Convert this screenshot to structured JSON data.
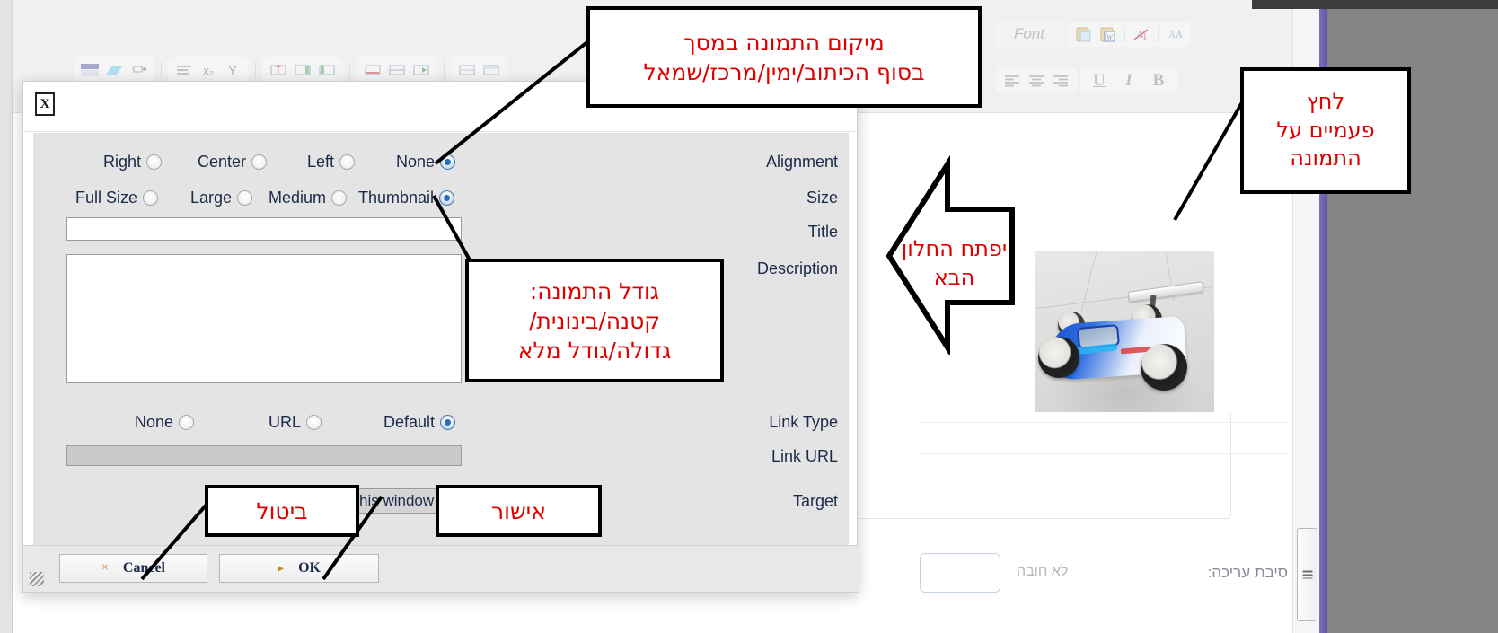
{
  "editor_toolbar": {
    "font_label": "Font",
    "row1_icons": [
      "table-icon",
      "shape-icon",
      "anchor-icon",
      "list-icon",
      "subscript-icon",
      "superscript-icon",
      "table-insert-icon",
      "table-column-right-icon",
      "table-column-left-icon",
      "table-row-delete-icon",
      "table-row-insert-icon",
      "table-merge-icon",
      "table-split-icon",
      "table-props-icon"
    ],
    "row2_icons": [
      "align-left-icon",
      "align-center-icon",
      "align-right-icon"
    ],
    "format_buttons": [
      "U",
      "I",
      "B"
    ],
    "clipboard_icons": [
      "paste-plain-icon",
      "paste-word-icon",
      "remove-format-icon",
      "format-painter-icon"
    ]
  },
  "dialog": {
    "close_label": "X",
    "alignment": {
      "label": "Alignment",
      "options": [
        {
          "label": "Right",
          "checked": false
        },
        {
          "label": "Center",
          "checked": false
        },
        {
          "label": "Left",
          "checked": false
        },
        {
          "label": "None",
          "checked": true
        }
      ]
    },
    "size": {
      "label": "Size",
      "options": [
        {
          "label": "Full Size",
          "checked": false
        },
        {
          "label": "Large",
          "checked": false
        },
        {
          "label": "Medium",
          "checked": false
        },
        {
          "label": "Thumbnail",
          "checked": true
        }
      ]
    },
    "title": {
      "label": "Title",
      "value": "",
      "placeholder": ""
    },
    "description": {
      "label": "Description",
      "value": "",
      "placeholder": ""
    },
    "link_type": {
      "label": "Link Type",
      "options": [
        {
          "label": "None",
          "checked": false
        },
        {
          "label": "URL",
          "checked": false
        },
        {
          "label": "Default",
          "checked": true
        }
      ]
    },
    "link_url": {
      "label": "Link URL",
      "value": ""
    },
    "target": {
      "label": "Target",
      "value": "Open in this window (_self)"
    },
    "buttons": {
      "cancel": "Cancel",
      "cancel_icon": "×",
      "ok": "OK",
      "ok_icon": "▸"
    }
  },
  "background_page": {
    "reason_label": "סיבת עריכה:",
    "reason_hint": "לא חובה",
    "reason_value": ""
  },
  "annotations": [
    {
      "name": "image-position-note",
      "lines": [
        "מיקום התמונה במסך",
        "בסוף הכיתוב/ימין/מרכז/שמאל"
      ]
    },
    {
      "name": "double-click-image-note",
      "lines": [
        "לחץ",
        "פעמיים על",
        "התמונה"
      ]
    },
    {
      "name": "next-window-arrow-note",
      "lines": [
        "יפתח החלון",
        "הבא"
      ]
    },
    {
      "name": "image-size-note",
      "lines": [
        "גודל התמונה:",
        "קטנה/בינונית/",
        "גדולה/גודל מלא"
      ]
    },
    {
      "name": "cancel-note",
      "lines": [
        "ביטול"
      ]
    },
    {
      "name": "ok-note",
      "lines": [
        "אישור"
      ]
    }
  ],
  "colors": {
    "annotation_text": "#e00000",
    "annotation_border": "#000000",
    "dialog_body": "#e4e4e4",
    "label_text": "#1c2a4a",
    "radio_checked": "#2a6bc4",
    "purple_strip": "#6a61ae",
    "gray_panel": "#848484"
  }
}
